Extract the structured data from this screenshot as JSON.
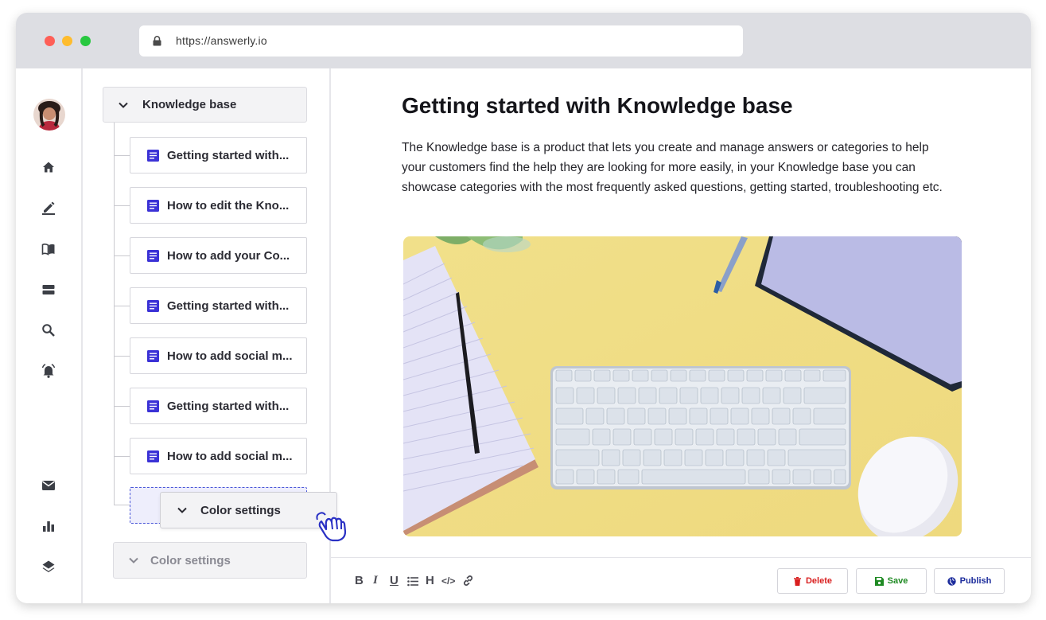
{
  "browser": {
    "url": "https://answerly.io"
  },
  "tree": {
    "root_label": "Knowledge base",
    "articles": [
      {
        "label": "Getting started with..."
      },
      {
        "label": "How to edit the Kno..."
      },
      {
        "label": "How to add your Co..."
      },
      {
        "label": "Getting started with..."
      },
      {
        "label": "How to add social m..."
      },
      {
        "label": "Getting started with..."
      },
      {
        "label": "How to add social m..."
      }
    ],
    "dragged_label": "Color settings",
    "bottom_label": "Color settings"
  },
  "article": {
    "title": "Getting started with Knowledge base",
    "body": "The Knowledge base is a product that lets you create and manage answers or categories to help your customers find the help they are looking for more easily, in your Knowledge base you can showcase categories with the most frequently asked questions, getting started, troubleshooting etc."
  },
  "toolbar": {
    "bold": "B",
    "italic": "I",
    "underline": "U",
    "heading": "H",
    "code": "</>",
    "delete_label": "Delete",
    "save_label": "Save",
    "publish_label": "Publish"
  },
  "colors": {
    "accent": "#3b32d6",
    "delete": "#d91f1f",
    "save": "#1f8a23",
    "publish": "#1c2c9c"
  }
}
